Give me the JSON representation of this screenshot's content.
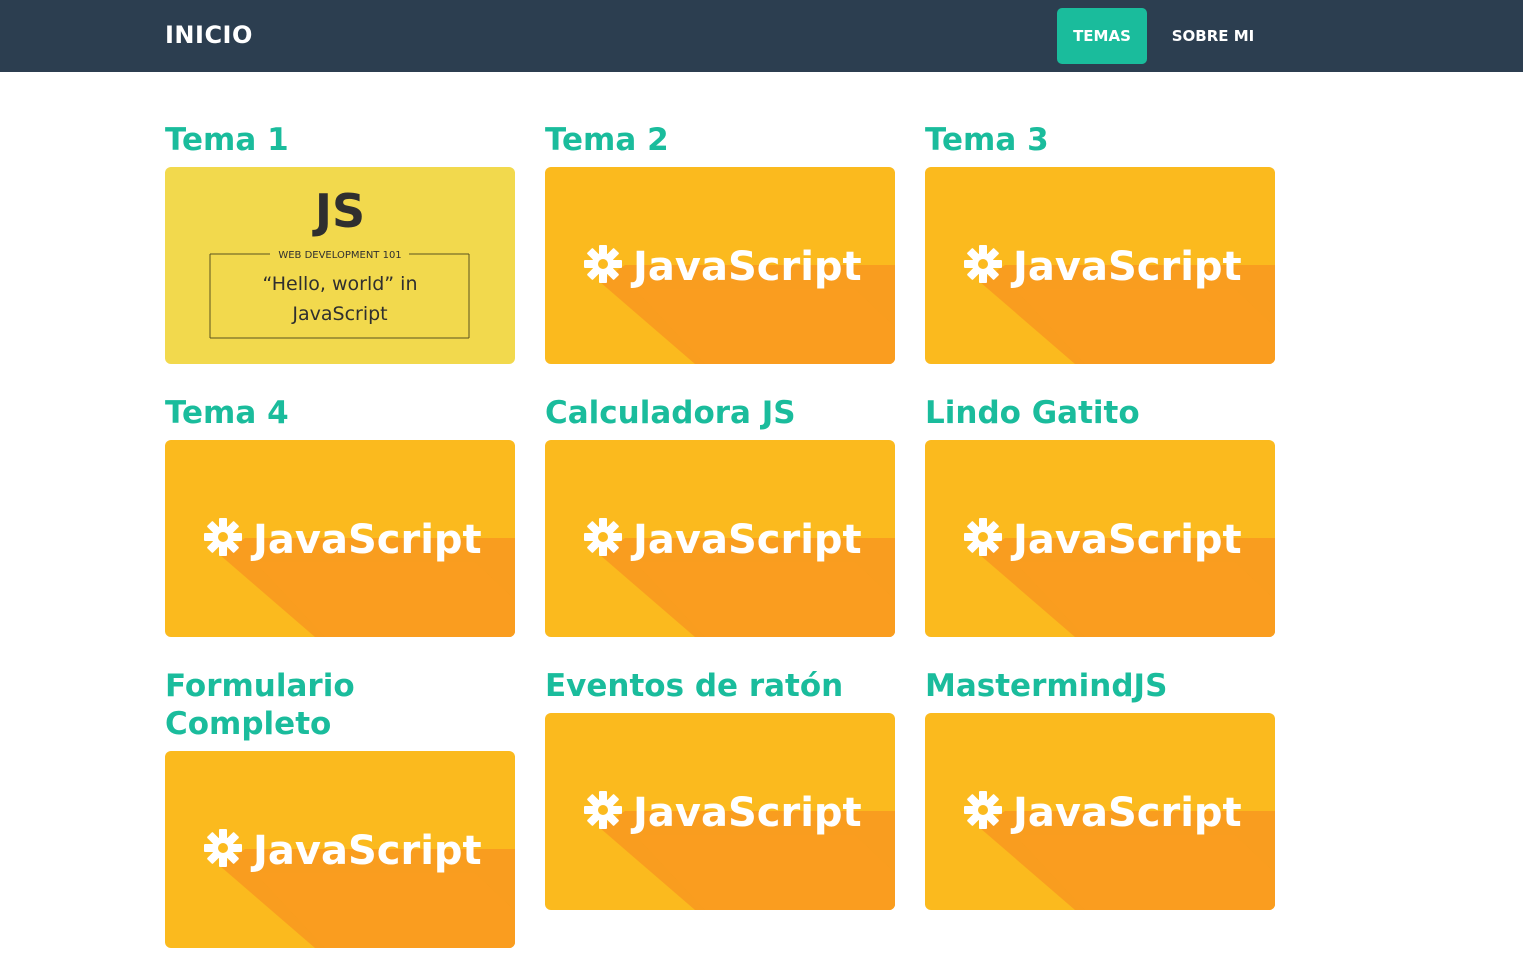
{
  "navbar": {
    "brand": "INICIO",
    "links": [
      {
        "label": "TEMAS",
        "active": true
      },
      {
        "label": "SOBRE MI",
        "active": false
      }
    ]
  },
  "colors": {
    "navbar_bg": "#2c3e50",
    "accent": "#1abc9c",
    "js_yellow": "#f2d94d",
    "js_orange": "#fbba1e",
    "js_orange_shadow": "#f99d1f"
  },
  "cards": [
    {
      "title": "Tema 1",
      "thumbnail": "js-hello-world"
    },
    {
      "title": "Tema 2",
      "thumbnail": "javascript-banner"
    },
    {
      "title": "Tema 3",
      "thumbnail": "javascript-banner"
    },
    {
      "title": "Tema 4",
      "thumbnail": "javascript-banner"
    },
    {
      "title": "Calculadora JS",
      "thumbnail": "javascript-banner"
    },
    {
      "title": "Lindo Gatito",
      "thumbnail": "javascript-banner"
    },
    {
      "title": "Formulario Completo",
      "thumbnail": "javascript-banner"
    },
    {
      "title": "Eventos de ratón",
      "thumbnail": "javascript-banner"
    },
    {
      "title": "MastermindJS",
      "thumbnail": "javascript-banner"
    }
  ],
  "thumb_text": {
    "js_logo": "JS",
    "js_kicker": "WEB DEVELOPMENT 101",
    "js_line1": "“Hello, world” in",
    "js_line2": "JavaScript",
    "banner_word": "JavaScript"
  }
}
